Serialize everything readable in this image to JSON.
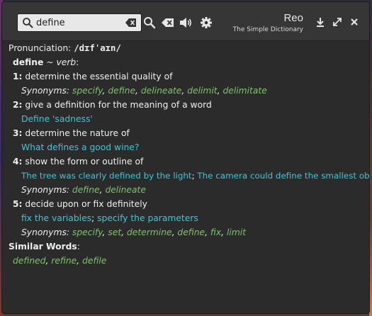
{
  "window": {
    "title": "Reo",
    "subtitle": "The Simple Dictionary"
  },
  "search": {
    "value": "define",
    "placeholder": ""
  },
  "entry": {
    "pronunciation_label": "Pronunciation:",
    "pronunciation": "/dɪfˈaɪn/",
    "word": "define",
    "pos_sep": " ~ ",
    "pos": "verb",
    "pos_colon": ":",
    "synonyms_label": "Synonyms:",
    "senses": [
      {
        "num": "1:",
        "definition": "determine the essential quality of",
        "synonyms": [
          "specify",
          "define",
          "delineate",
          "delimit",
          "delimitate"
        ]
      },
      {
        "num": "2:",
        "definition": "give a definition for the meaning of a word",
        "examples": [
          "Define 'sadness'"
        ]
      },
      {
        "num": "3:",
        "definition": "determine the nature of",
        "examples": [
          "What defines a good wine?"
        ]
      },
      {
        "num": "4:",
        "definition": "show the form or outline of",
        "examples": [
          "The tree was clearly defined by the light",
          "The camera could define the smallest object"
        ],
        "synonyms": [
          "define",
          "delineate"
        ]
      },
      {
        "num": "5:",
        "definition": "decide upon or fix definitely",
        "examples": [
          "fix the variables",
          "specify the parameters"
        ],
        "synonyms": [
          "specify",
          "set",
          "determine",
          "define",
          "fix",
          "limit"
        ]
      }
    ],
    "similar_label": "Similar Words",
    "similar_colon": ":",
    "similar": [
      "defined",
      "refine",
      "defile"
    ]
  },
  "separators": {
    "comma": ", ",
    "semicolon": "; "
  },
  "colors": {
    "synonym": "#7ec36a",
    "example": "#3dc7d6",
    "text": "#efefef",
    "background": "#2b2b2b"
  }
}
